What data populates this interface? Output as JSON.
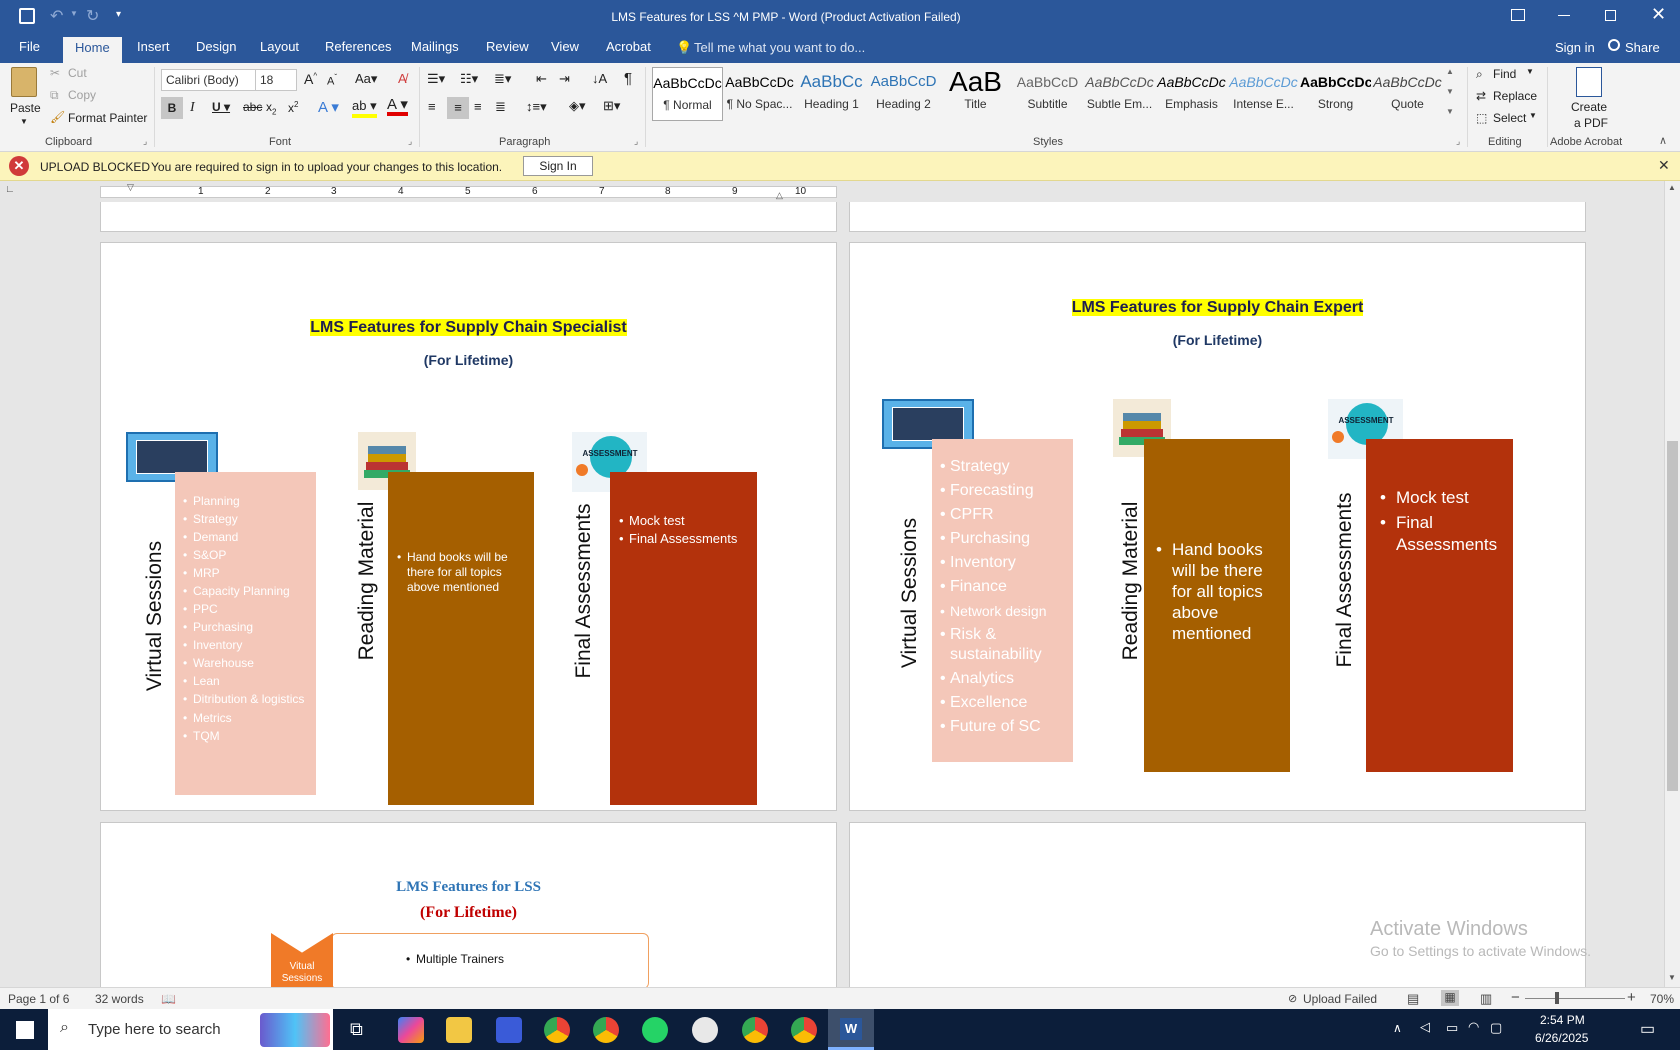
{
  "window": {
    "title": "LMS Features for LSS ^M PMP - Word (Product Activation Failed)"
  },
  "ribbon_tabs": [
    "File",
    "Home",
    "Insert",
    "Design",
    "Layout",
    "References",
    "Mailings",
    "Review",
    "View",
    "Acrobat"
  ],
  "tell_me": "Tell me what you want to do...",
  "account": {
    "signin": "Sign in",
    "share": "Share"
  },
  "clipboard": {
    "paste": "Paste",
    "cut": "Cut",
    "copy": "Copy",
    "format_painter": "Format Painter",
    "label": "Clipboard"
  },
  "font": {
    "name": "Calibri (Body)",
    "size": "18",
    "label": "Font"
  },
  "paragraph": {
    "label": "Paragraph"
  },
  "styles": {
    "label": "Styles",
    "items": [
      {
        "preview": "AaBbCcDc",
        "name": "¶ Normal"
      },
      {
        "preview": "AaBbCcDc",
        "name": "¶ No Spac..."
      },
      {
        "preview": "AaBbCc",
        "name": "Heading 1"
      },
      {
        "preview": "AaBbCcD",
        "name": "Heading 2"
      },
      {
        "preview": "AaB",
        "name": "Title"
      },
      {
        "preview": "AaBbCcD",
        "name": "Subtitle"
      },
      {
        "preview": "AaBbCcDc",
        "name": "Subtle Em..."
      },
      {
        "preview": "AaBbCcDc",
        "name": "Emphasis"
      },
      {
        "preview": "AaBbCcDc",
        "name": "Intense E..."
      },
      {
        "preview": "AaBbCcDc",
        "name": "Strong"
      },
      {
        "preview": "AaBbCcDc",
        "name": "Quote"
      }
    ]
  },
  "editing": {
    "find": "Find",
    "replace": "Replace",
    "select": "Select",
    "label": "Editing"
  },
  "acrobat": {
    "create_line1": "Create",
    "create_line2": "a PDF",
    "label": "Adobe Acrobat"
  },
  "message_bar": {
    "title": "UPLOAD BLOCKED",
    "text": "You are required to sign in to upload your changes to this location.",
    "button": "Sign In"
  },
  "ruler_numbers": [
    "1",
    "2",
    "3",
    "4",
    "5",
    "6",
    "7",
    "8",
    "9",
    "10"
  ],
  "page_specialist": {
    "title": "LMS Features for Supply Chain Specialist",
    "subtitle": "(For Lifetime)",
    "col1_label": "Virtual Sessions",
    "col1_items": [
      "Planning",
      "Strategy",
      "Demand",
      "S&OP",
      "MRP",
      "Capacity Planning",
      "PPC",
      "Purchasing",
      "Inventory",
      "Warehouse",
      "Lean",
      "Ditribution & logistics",
      "Metrics",
      "TQM"
    ],
    "col2_label": "Reading Material",
    "col2_items": [
      "Hand books will be there for all topics above mentioned"
    ],
    "col3_label": "Final Assessments",
    "col3_items": [
      "Mock test",
      "Final Assessments"
    ],
    "assess_text": "ASSESSMENT"
  },
  "page_expert": {
    "title": "LMS Features for Supply Chain Expert",
    "subtitle": "(For Lifetime)",
    "col1_label": "Virtual Sessions",
    "col1_items": [
      "Strategy",
      "Forecasting",
      " CPFR",
      "Purchasing",
      "Inventory",
      "Finance",
      "Network design",
      "Risk & sustainability",
      "Analytics",
      "Excellence",
      "Future of SC"
    ],
    "col2_label": "Reading Material",
    "col2_items": [
      "Hand books will be there for all topics above mentioned"
    ],
    "col3_label": "Final Assessments",
    "col3_items": [
      "Mock test",
      "Final Assessments"
    ],
    "assess_text": "ASSESSMENT"
  },
  "page_lss": {
    "title": "LMS Features for LSS",
    "subtitle": "(For Lifetime)",
    "chevron_label": "Vitual Sessions",
    "item": "Multiple Trainers"
  },
  "watermark": {
    "line1": "Activate Windows",
    "line2": "Go to Settings to activate Windows."
  },
  "status": {
    "page": "Page 1 of 6",
    "words": "32 words",
    "upload": "Upload Failed",
    "zoom": "70%"
  },
  "taskbar": {
    "search_placeholder": "Type here to search",
    "time": "2:54 PM",
    "date": "6/26/2025"
  },
  "colors": {
    "word_blue": "#2b579a",
    "pink": "#f4c7b9",
    "brown": "#a55f00",
    "rust": "#b3320c",
    "highlight": "#ffff00"
  }
}
